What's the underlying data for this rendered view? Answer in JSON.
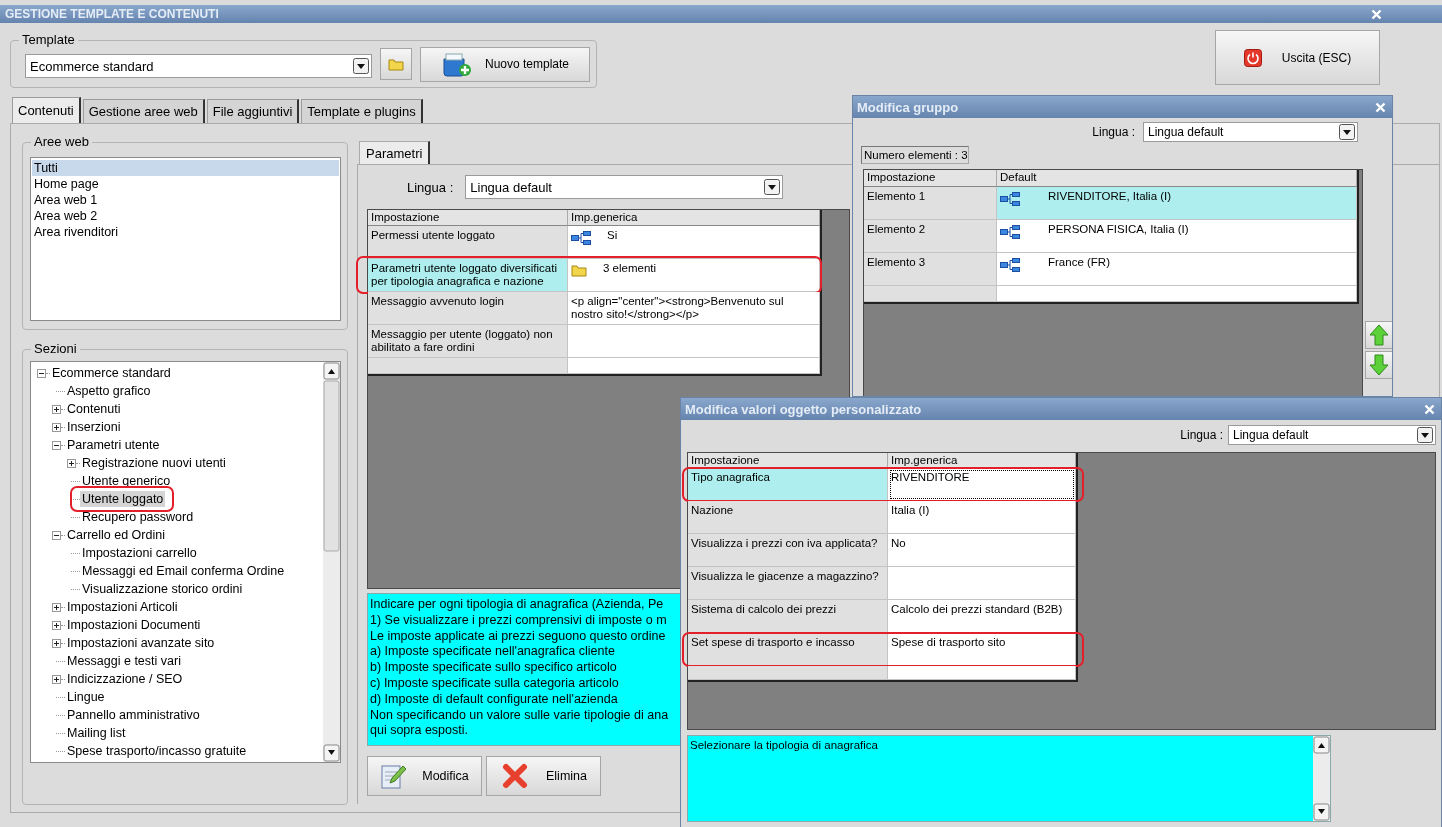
{
  "main_window": {
    "title": "GESTIONE TEMPLATE E CONTENUTI"
  },
  "template": {
    "label": "Template",
    "value": "Ecommerce standard",
    "new_button": "Nuovo template"
  },
  "exit_button": "Uscita (ESC)",
  "tabs": [
    {
      "label": "Contenuti",
      "selected": true
    },
    {
      "label": "Gestione aree web",
      "selected": false
    },
    {
      "label": "File aggiuntivi",
      "selected": false
    },
    {
      "label": "Template e plugins",
      "selected": false
    }
  ],
  "web_areas": {
    "label": "Aree web",
    "items": [
      {
        "label": "Tutti",
        "selected": true
      },
      {
        "label": "Home page",
        "selected": false
      },
      {
        "label": "Area web 1",
        "selected": false
      },
      {
        "label": "Area web 2",
        "selected": false
      },
      {
        "label": "Area rivenditori",
        "selected": false
      }
    ]
  },
  "sections": {
    "label": "Sezioni",
    "tree": [
      {
        "label": "Ecommerce standard",
        "expanded": true,
        "selected": false,
        "children": [
          {
            "label": "Aspetto grafico",
            "selected": false
          },
          {
            "label": "Contenuti",
            "expanded": false,
            "selected": false
          },
          {
            "label": "Inserzioni",
            "expanded": false,
            "selected": false
          },
          {
            "label": "Parametri utente",
            "expanded": true,
            "selected": false,
            "children": [
              {
                "label": "Registrazione nuovi utenti",
                "expanded": false,
                "selected": false
              },
              {
                "label": "Utente generico",
                "selected": false
              },
              {
                "label": "Utente loggato",
                "selected": true,
                "highlighted": true
              },
              {
                "label": "Recupero password",
                "selected": false
              }
            ]
          },
          {
            "label": "Carrello ed Ordini",
            "expanded": true,
            "selected": false,
            "children": [
              {
                "label": "Impostazioni carrello",
                "selected": false
              },
              {
                "label": "Messaggi ed Email conferma Ordine",
                "selected": false
              },
              {
                "label": "Visualizzazione storico ordini",
                "selected": false
              }
            ]
          },
          {
            "label": "Impostazioni Articoli",
            "expanded": false,
            "selected": false
          },
          {
            "label": "Impostazioni Documenti",
            "expanded": false,
            "selected": false
          },
          {
            "label": "Impostazioni avanzate sito",
            "expanded": false,
            "selected": false
          },
          {
            "label": "Messaggi e testi vari",
            "selected": false
          },
          {
            "label": "Indicizzazione / SEO",
            "expanded": false,
            "selected": false
          },
          {
            "label": "Lingue",
            "selected": false
          },
          {
            "label": "Pannello amministrativo",
            "selected": false
          },
          {
            "label": "Mailing list",
            "selected": false
          },
          {
            "label": "Spese trasporto/incasso gratuite",
            "selected": false
          }
        ]
      }
    ]
  },
  "parameters": {
    "tab": "Parametri",
    "language_label": "Lingua :",
    "language": "Lingua default",
    "columns": [
      "Impostazione",
      "Imp.generica"
    ],
    "rows": [
      {
        "setting": "Permessi utente loggato",
        "kind": "hierarchy",
        "value": "Si",
        "selected": false,
        "highlighted": false
      },
      {
        "setting": "Parametri utente loggato diversificati per tipologia anagrafica e nazione",
        "kind": "group",
        "value": "3 elementi",
        "selected": true,
        "highlighted": true
      },
      {
        "setting": "Messaggio avvenuto login",
        "kind": "text",
        "value": "<p align=\"center\"><strong>Benvenuto sul nostro sito!</strong></p>",
        "selected": false,
        "highlighted": false
      },
      {
        "setting": "Messaggio per utente (loggato) non abilitato a fare ordini",
        "kind": "text",
        "selected": false,
        "highlighted": false
      }
    ],
    "help_lines": [
      "Indicare per ogni tipologia di anagrafica (Azienda, Pe",
      "1) Se visualizzare i prezzi comprensivi di imposte o m",
      "Le imposte applicate ai prezzi seguono questo ordine",
      "a) Imposte specificate nell'anagrafica cliente",
      "b) Imposte specificate sullo specifico articolo",
      "c) Imposte specificate sulla categoria articolo",
      "d) Imposte di default configurate nell'azienda",
      "Non specificando un valore sulle varie tipologie di ana",
      "qui sopra esposti."
    ],
    "buttons": [
      {
        "kind": "edit",
        "label": "Modifica"
      },
      {
        "kind": "delete",
        "label": "Elimina"
      }
    ]
  },
  "group_dialog": {
    "title": "Modifica gruppo",
    "language_label": "Lingua :",
    "language": "Lingua default",
    "count": "Numero elementi : 3",
    "columns": [
      "Impostazione",
      "Default"
    ],
    "rows": [
      {
        "setting": "Elemento 1",
        "value": "RIVENDITORE, Italia (I)",
        "selected": true
      },
      {
        "setting": "Elemento 2",
        "value": "PERSONA FISICA, Italia (I)",
        "selected": false
      },
      {
        "setting": "Elemento 3",
        "value": "France (FR)",
        "selected": false
      }
    ]
  },
  "values_dialog": {
    "title": "Modifica valori oggetto personalizzato",
    "language_label": "Lingua :",
    "language": "Lingua default",
    "columns": [
      "Impostazione",
      "Imp.generica"
    ],
    "rows": [
      {
        "setting": "Tipo anagrafica",
        "value": "RIVENDITORE",
        "selected": true,
        "highlighted": true
      },
      {
        "setting": "Nazione",
        "value": "Italia (I)",
        "selected": false,
        "highlighted": false
      },
      {
        "setting": "Visualizza i prezzi con iva applicata?",
        "value": "No",
        "selected": false,
        "highlighted": false
      },
      {
        "setting": "Visualizza le giacenze a magazzino?",
        "selected": false,
        "highlighted": false
      },
      {
        "setting": "Sistema di calcolo dei prezzi",
        "value": "Calcolo dei prezzi standard (B2B)",
        "selected": false,
        "highlighted": false
      },
      {
        "setting": "Set spese di trasporto e incasso",
        "value": "Spese di trasporto sito",
        "selected": false,
        "highlighted": true
      }
    ],
    "help": "Selezionare la tipologia di anagrafica"
  }
}
